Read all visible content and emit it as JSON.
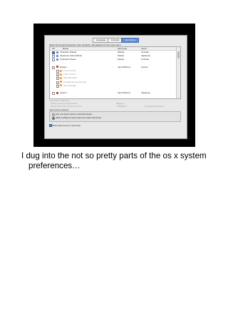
{
  "prefs": {
    "tabs": [
      "Language",
      "Formats",
      "Input Menu"
    ],
    "active_tab": "Input Menu",
    "instruction": "Select the keyboard layouts, input methods, and palettes for the Input menu.",
    "columns": [
      "On",
      "Name",
      "Input type",
      "Script"
    ],
    "rows": [
      {
        "on": true,
        "name": "Character Palette",
        "type": "Palette",
        "script": "Unicode",
        "indent": false
      },
      {
        "on": false,
        "name": "Japanese Kana Palette",
        "type": "Palette",
        "script": "Japanese",
        "indent": false
      },
      {
        "on": false,
        "name": "Keyboard Viewer",
        "type": "Palette",
        "script": "Unicode",
        "indent": false
      },
      {
        "on": false,
        "name": "",
        "type": "",
        "script": "",
        "indent": false
      },
      {
        "on": false,
        "name": "Hangul",
        "type": "Input Method",
        "script": "Korean",
        "indent": false
      },
      {
        "on": false,
        "name": "2-Set Korean",
        "type": "",
        "script": "",
        "indent": true
      },
      {
        "on": false,
        "name": "3-Set Korean",
        "type": "",
        "script": "",
        "indent": true
      },
      {
        "on": false,
        "name": "390 Sebulshik",
        "type": "",
        "script": "",
        "indent": true
      },
      {
        "on": false,
        "name": "GongjinCheong Romaja",
        "type": "",
        "script": "",
        "indent": true
      },
      {
        "on": false,
        "name": "HNC Romaja",
        "type": "",
        "script": "",
        "indent": true
      },
      {
        "on": false,
        "name": "",
        "type": "",
        "script": "",
        "indent": false
      },
      {
        "on": false,
        "name": "Kotoeri",
        "type": "Input Method",
        "script": "Japanese",
        "indent": false
      }
    ],
    "shortcuts_title": "Input Menu Shortcuts",
    "shortcuts": [
      {
        "label": "Select previous input source",
        "key": "⌘Space",
        "extra": ""
      },
      {
        "label": "Select next input source in menu",
        "key": "⌥⌘Space",
        "extra": "Keyboard Shortcuts…"
      }
    ],
    "options_title": "Input source options",
    "options": [
      {
        "label": "Use one input source in all documents",
        "selected": false
      },
      {
        "label": "Allow a different input source for each document",
        "selected": true
      }
    ],
    "show_menu_label": "Show input menu in menu bar",
    "show_menu_checked": true
  },
  "caption": {
    "line1": "I dug into the not so pretty parts of the os x system",
    "line2": "preferences…"
  }
}
